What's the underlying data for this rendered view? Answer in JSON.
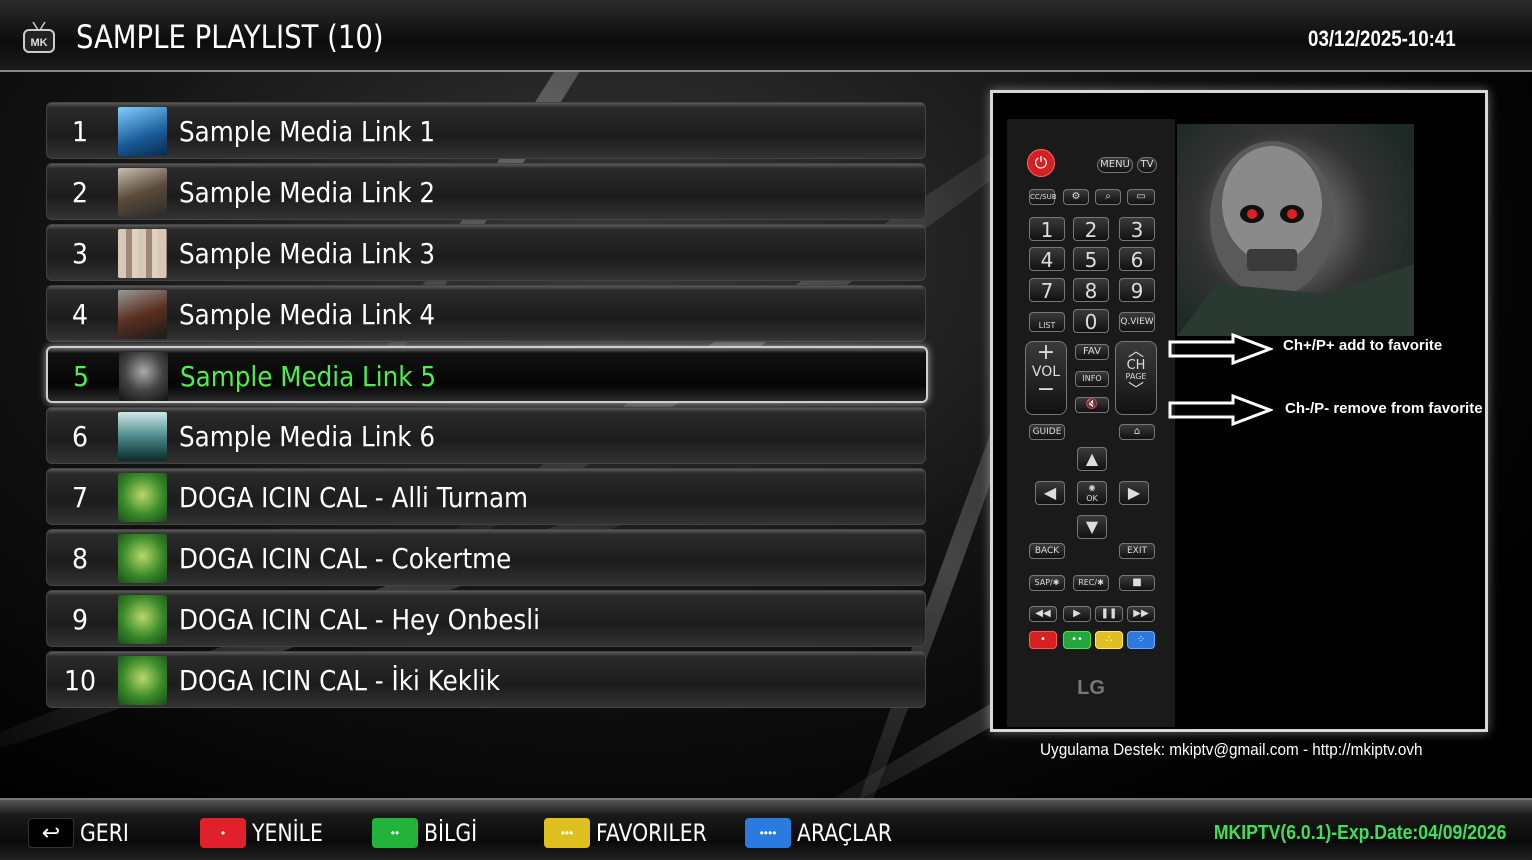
{
  "header": {
    "title": "SAMPLE PLAYLIST (10)",
    "datetime": "03/12/2025-10:41",
    "logo_text": "MK"
  },
  "playlist": [
    {
      "num": "1",
      "title": "Sample Media Link 1",
      "thumb": "aquaman"
    },
    {
      "num": "2",
      "title": "Sample Media Link 2",
      "thumb": "woman"
    },
    {
      "num": "3",
      "title": "Sample Media Link 3",
      "thumb": "collage"
    },
    {
      "num": "4",
      "title": "Sample Media Link 4",
      "thumb": "action"
    },
    {
      "num": "5",
      "title": "Sample Media Link 5",
      "thumb": "terminator",
      "selected": true
    },
    {
      "num": "6",
      "title": "Sample Media Link 6",
      "thumb": "matrix"
    },
    {
      "num": "7",
      "title": "DOGA ICIN CAL - Alli Turnam",
      "thumb": "doga"
    },
    {
      "num": "8",
      "title": "DOGA ICIN CAL - Cokertme",
      "thumb": "doga"
    },
    {
      "num": "9",
      "title": "DOGA ICIN CAL - Hey Onbesli",
      "thumb": "doga"
    },
    {
      "num": "10",
      "title": "DOGA ICIN CAL - İki Keklik",
      "thumb": "doga"
    }
  ],
  "preview": {
    "note_add": "Ch+/P+ add to favorite",
    "note_remove": "Ch-/P- remove from favorite",
    "remote": {
      "menu": "MENU",
      "tv": "TV",
      "ccsub": "CC/SUB",
      "list": "LIST",
      "qview": "Q.VIEW",
      "vol": "VOL",
      "fav": "FAV",
      "info": "INFO",
      "ch": "CH",
      "page": "PAGE",
      "guide": "GUIDE",
      "ok": "OK",
      "back": "BACK",
      "exit": "EXIT",
      "sap": "SAP/✱",
      "rec": "REC/✱",
      "brand": "LG",
      "digits": [
        "1",
        "2",
        "3",
        "4",
        "5",
        "6",
        "7",
        "8",
        "9",
        "0"
      ]
    }
  },
  "support": "Uygulama Destek: mkiptv@gmail.com - http://mkiptv.ovh",
  "footer": {
    "back": "GERI",
    "refresh": "YENİLE",
    "info": "BİLGİ",
    "favorites": "FAVORILER",
    "tools": "ARAÇLAR",
    "version": "MKIPTV(6.0.1)-Exp.Date:04/09/2026",
    "colors": {
      "red": "#e0202a",
      "green": "#22b43a",
      "yellow": "#e0c020",
      "blue": "#2a7ae0"
    }
  }
}
